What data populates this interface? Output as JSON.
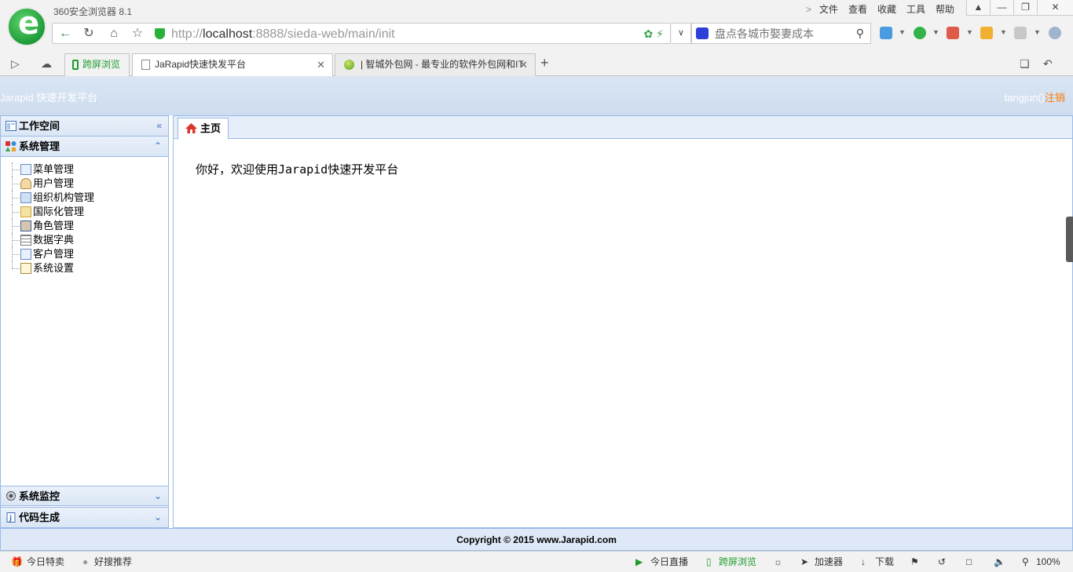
{
  "browser": {
    "title": "360安全浏览器 8.1",
    "menu": [
      "文件",
      "查看",
      "收藏",
      "工具",
      "帮助"
    ],
    "url_prefix": "http://",
    "url_host": "localhost",
    "url_rest": ":8888/sieda-web/main/init",
    "search_placeholder": "盘点各城市娶妻成本",
    "tabs": [
      {
        "label": "跨屏浏览"
      },
      {
        "label": "JaRapid快速快发平台"
      },
      {
        "label": "| 智城外包网 - 最专业的软件外包网和IT"
      }
    ],
    "new_tab": "+"
  },
  "app": {
    "brand": "Jarapid 快速开发平台",
    "username": "tangjun()",
    "logout": "注销",
    "accordion": {
      "workspace": "工作空间",
      "system_mgmt": "系统管理",
      "monitor": "系统监控",
      "codegen": "代码生成"
    },
    "menu_items": [
      "菜单管理",
      "用户管理",
      "组织机构管理",
      "国际化管理",
      "角色管理",
      "数据字典",
      "客户管理",
      "系统设置"
    ],
    "home_tab": "主页",
    "welcome": "你好，欢迎使用Jarapid快速开发平台",
    "footer": "Copyright © 2015 www.Jarapid.com"
  },
  "statusbar": {
    "left": [
      "今日特卖",
      "好搜推荐"
    ],
    "right": [
      "今日直播",
      "跨屏浏览",
      "加速器",
      "下载"
    ],
    "zoom": "100%"
  },
  "colors": {
    "accent_green": "#1e9c2b",
    "panel_border": "#99bbe8",
    "header_bg": "#cddcef",
    "logout": "#ff7a00"
  }
}
